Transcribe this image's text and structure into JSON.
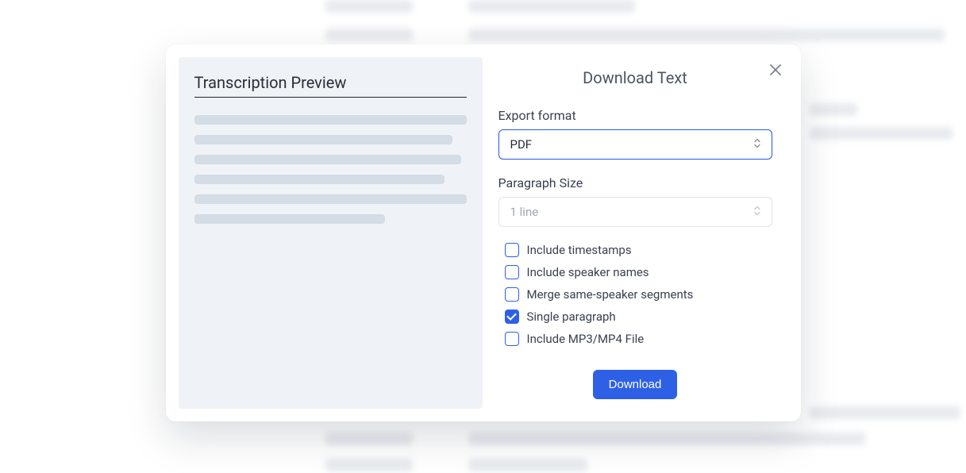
{
  "modal": {
    "preview_title": "Transcription Preview",
    "title": "Download Text",
    "export_format_label": "Export format",
    "export_format_value": "PDF",
    "paragraph_size_label": "Paragraph Size",
    "paragraph_size_value": "1 line",
    "checkboxes": {
      "timestamps": {
        "label": "Include timestamps",
        "checked": false
      },
      "speaker_names": {
        "label": "Include speaker names",
        "checked": false
      },
      "merge_segments": {
        "label": "Merge same-speaker segments",
        "checked": false
      },
      "single_paragraph": {
        "label": "Single paragraph",
        "checked": true
      },
      "include_media": {
        "label": "Include MP3/MP4 File",
        "checked": false
      }
    },
    "download_button": "Download"
  }
}
